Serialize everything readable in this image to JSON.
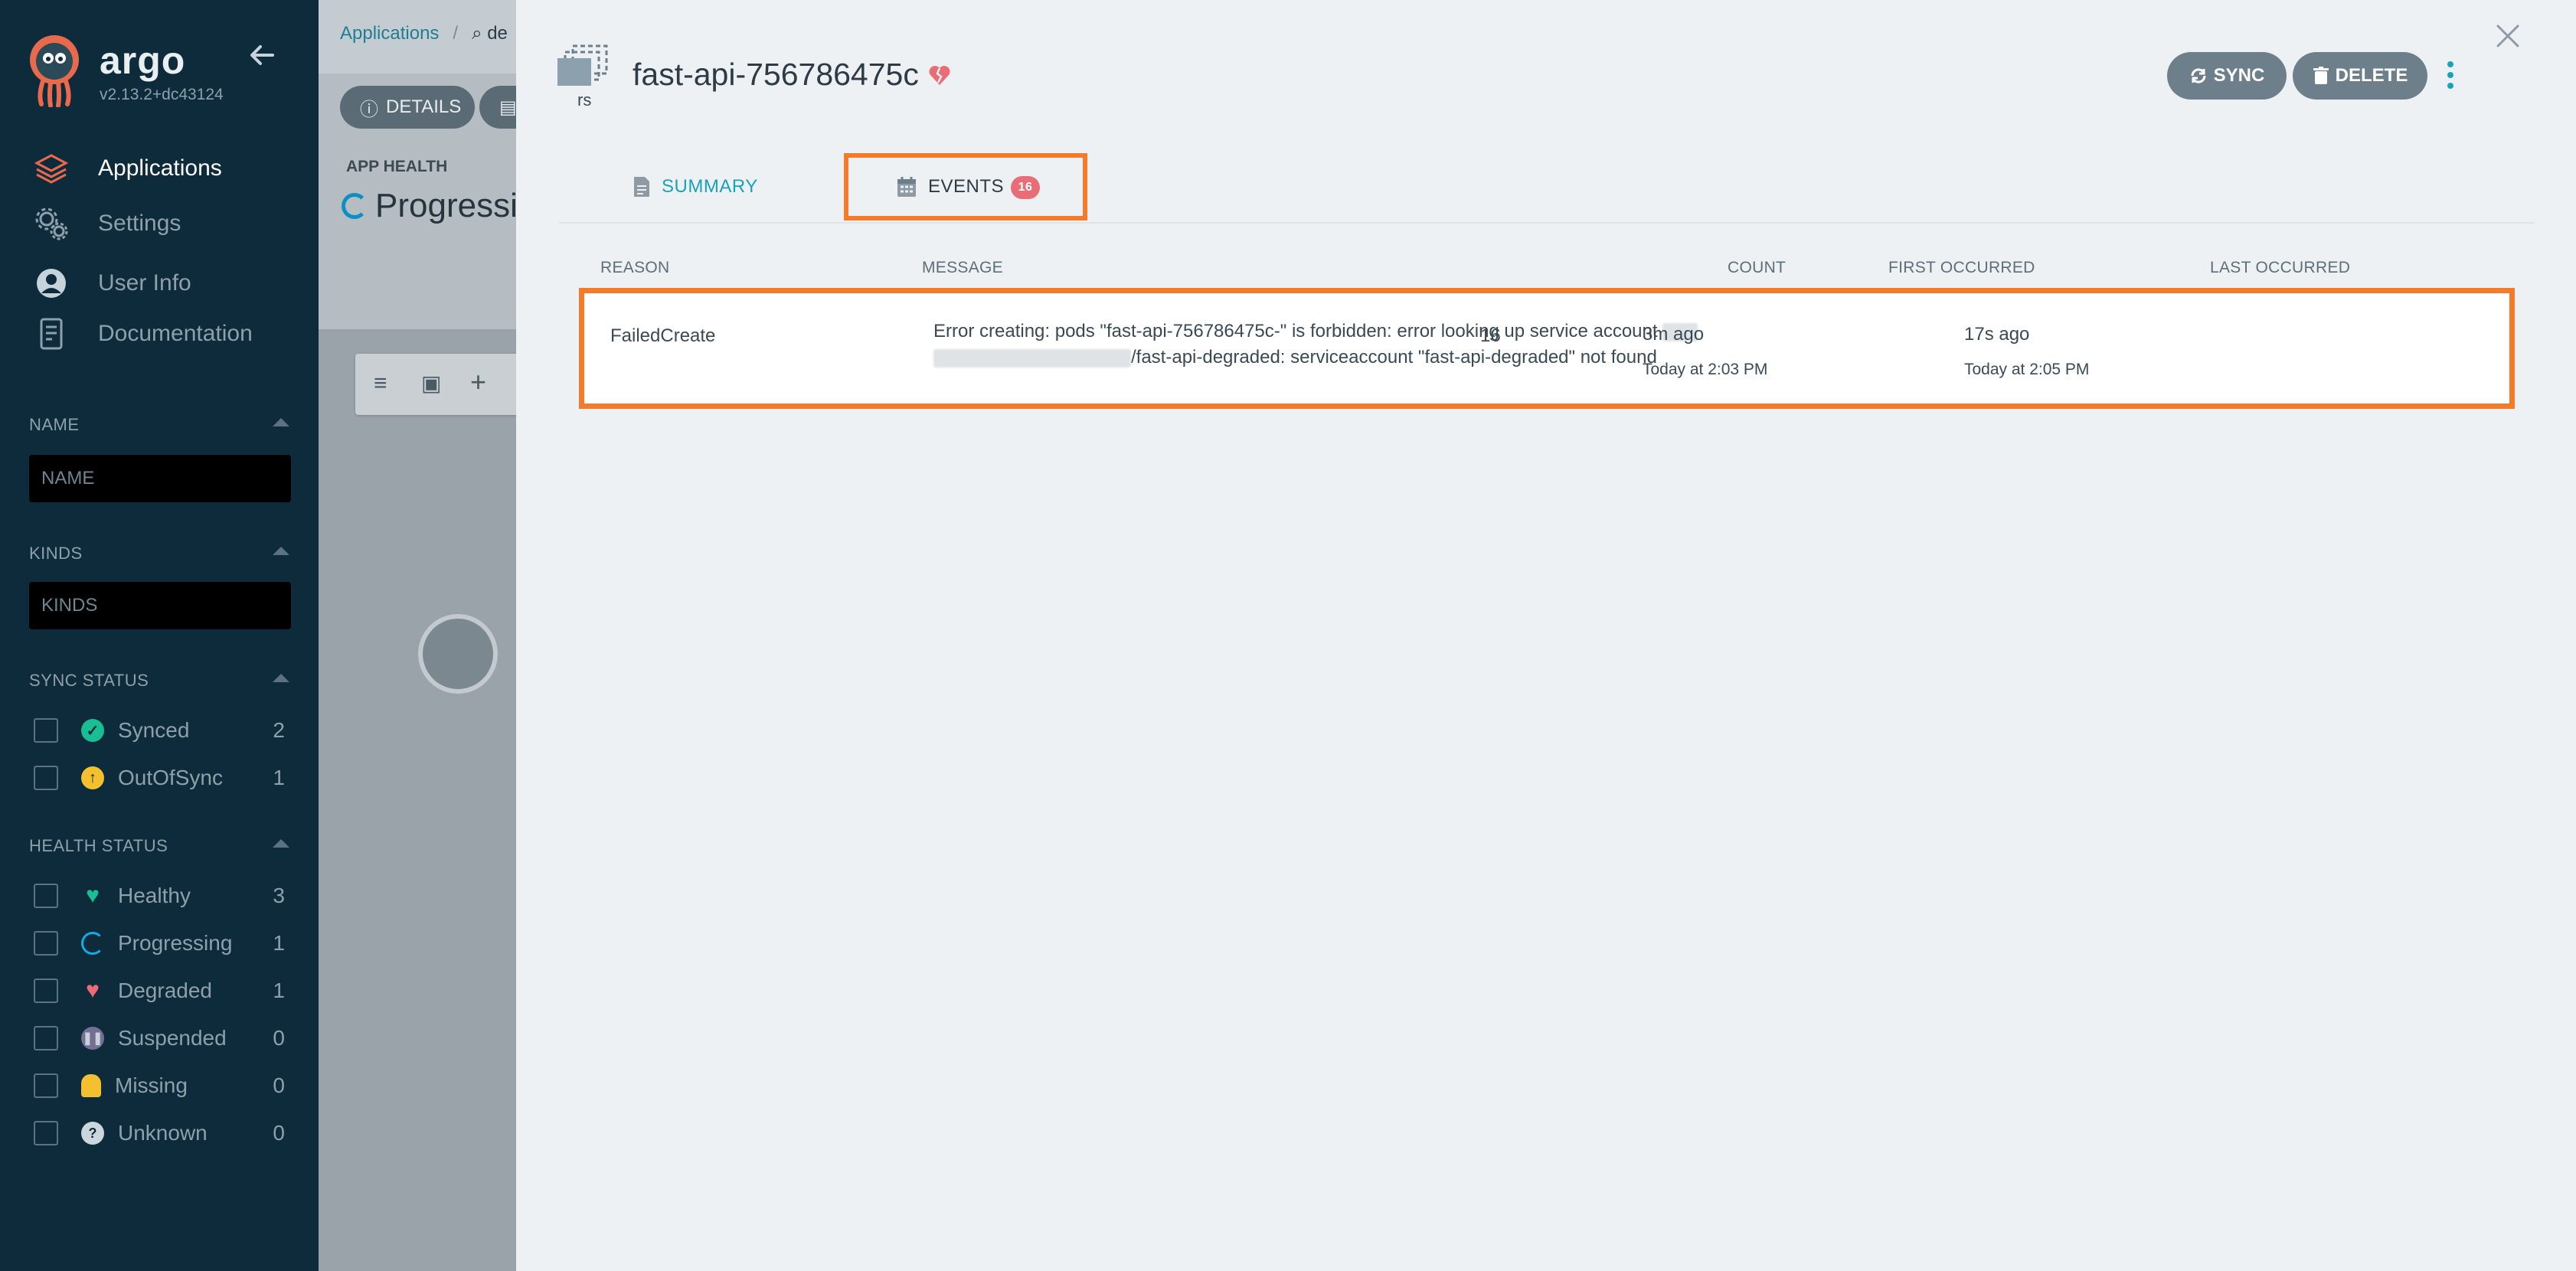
{
  "sidebar": {
    "brand": "argo",
    "version": "v2.13.2+dc43124",
    "nav": [
      {
        "label": "Applications",
        "icon": "layers-icon"
      },
      {
        "label": "Settings",
        "icon": "gears-icon"
      },
      {
        "label": "User Info",
        "icon": "user-circle-icon"
      },
      {
        "label": "Documentation",
        "icon": "book-icon"
      }
    ],
    "name_filter": {
      "title": "NAME",
      "placeholder": "NAME"
    },
    "kinds_filter": {
      "title": "KINDS",
      "placeholder": "KINDS"
    },
    "sync_status": {
      "title": "SYNC STATUS",
      "items": [
        {
          "label": "Synced",
          "count": "2",
          "color": "#18be94"
        },
        {
          "label": "OutOfSync",
          "count": "1",
          "color": "#f4c030"
        }
      ]
    },
    "health_status": {
      "title": "HEALTH STATUS",
      "items": [
        {
          "label": "Healthy",
          "count": "3",
          "color": "#18be94"
        },
        {
          "label": "Progressing",
          "count": "1",
          "color": "#0dadea"
        },
        {
          "label": "Degraded",
          "count": "1",
          "color": "#e96d76"
        },
        {
          "label": "Suspended",
          "count": "0",
          "color": "#766f94"
        },
        {
          "label": "Missing",
          "count": "0",
          "color": "#f4c030"
        },
        {
          "label": "Unknown",
          "count": "0",
          "color": "#ccd6dd"
        }
      ]
    }
  },
  "background": {
    "breadcrumb": "Applications",
    "search_partial": "de",
    "details_button": "DETAILS",
    "app_health_label": "APP HEALTH",
    "app_health_value": "Progressi"
  },
  "panel": {
    "kind_short": "rs",
    "title": "fast-api-756786475c",
    "sync_label": "SYNC",
    "delete_label": "DELETE",
    "tabs": {
      "summary": "SUMMARY",
      "events": "EVENTS",
      "events_badge": "16"
    },
    "table": {
      "headers": {
        "reason": "REASON",
        "message": "MESSAGE",
        "count": "COUNT",
        "first": "FIRST OCCURRED",
        "last": "LAST OCCURRED"
      },
      "rows": [
        {
          "reason": "FailedCreate",
          "message_line1": "Error creating: pods \"fast-api-756786475c-\" is forbidden: error looking up service account",
          "message_line2": "/fast-api-degraded: serviceaccount \"fast-api-degraded\" not found",
          "count": "16",
          "first_rel": "3m ago",
          "first_abs": "Today at 2:03 PM",
          "last_rel": "17s ago",
          "last_abs": "Today at 2:05 PM"
        }
      ]
    }
  },
  "colors": {
    "accent": "#18a3b8",
    "highlight": "#f47b2a",
    "sidebar_bg": "#0e2b3b",
    "degraded": "#e96d76"
  }
}
